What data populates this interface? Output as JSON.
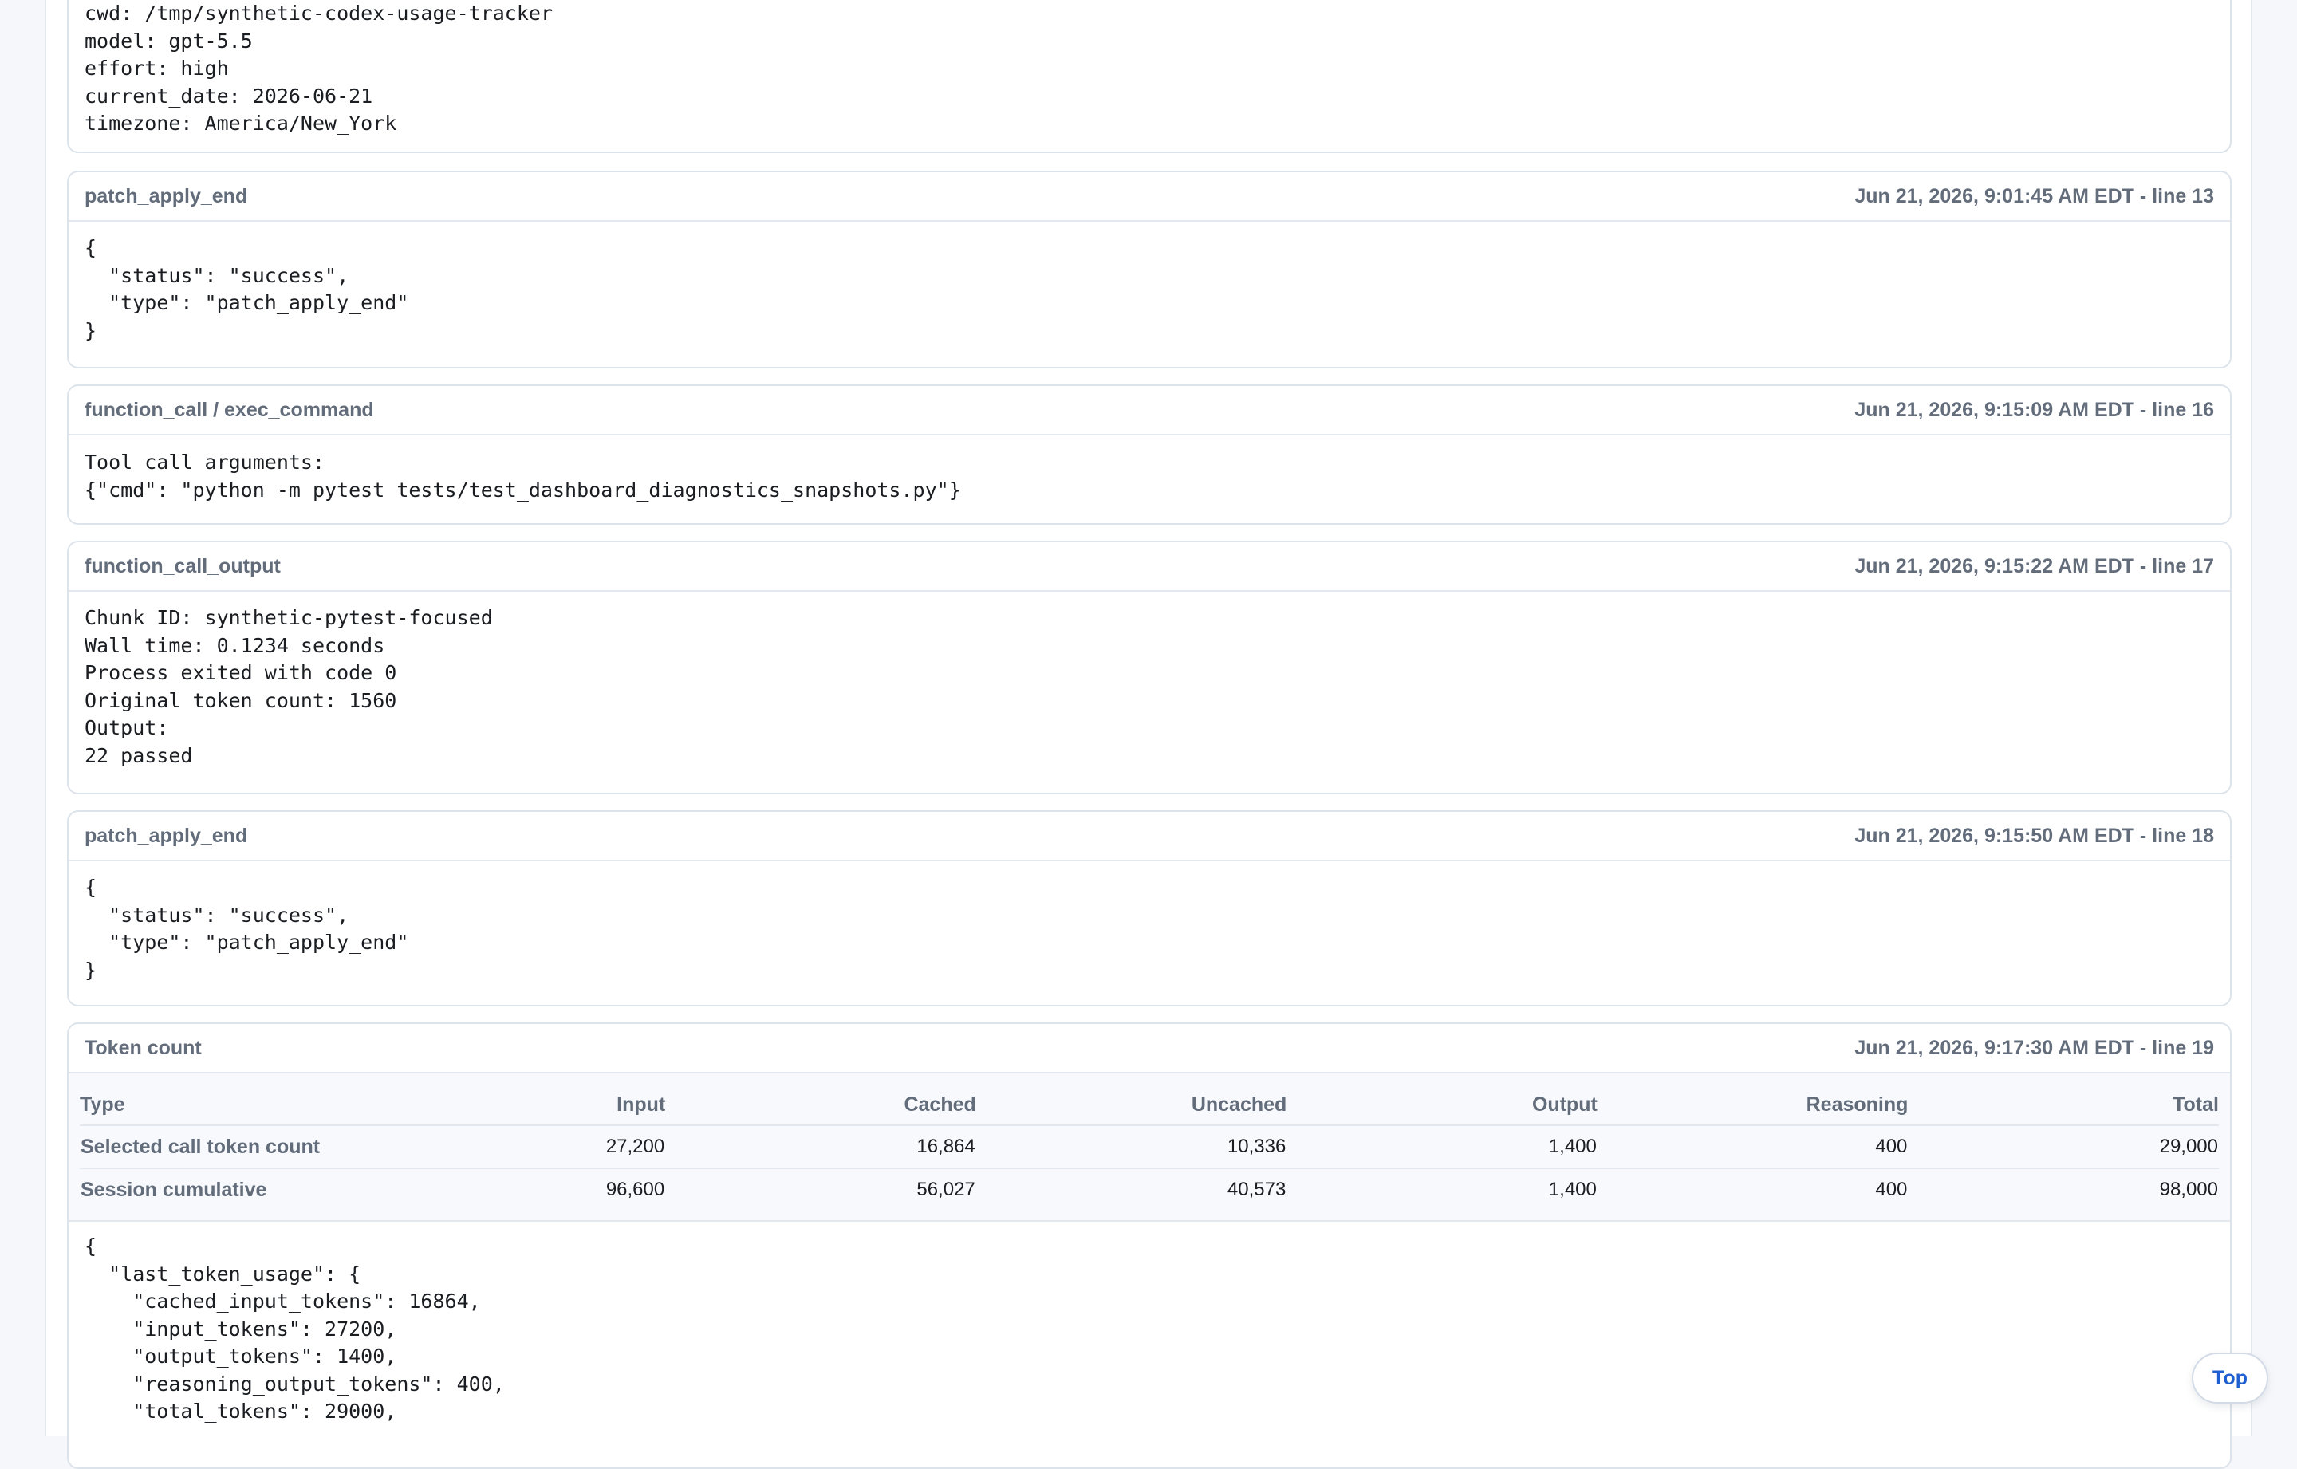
{
  "session_info": {
    "lines": [
      "cwd: /tmp/synthetic-codex-usage-tracker",
      "model: gpt-5.5",
      "effort: high",
      "current_date: 2026-06-21",
      "timezone: America/New_York"
    ]
  },
  "events": [
    {
      "title": "patch_apply_end",
      "meta": "Jun 21, 2026, 9:01:45 AM EDT - line 13",
      "body": "{\n  \"status\": \"success\",\n  \"type\": \"patch_apply_end\"\n}"
    },
    {
      "title": "function_call / exec_command",
      "meta": "Jun 21, 2026, 9:15:09 AM EDT - line 16",
      "body": "Tool call arguments:\n{\"cmd\": \"python -m pytest tests/test_dashboard_diagnostics_snapshots.py\"}"
    },
    {
      "title": "function_call_output",
      "meta": "Jun 21, 2026, 9:15:22 AM EDT - line 17",
      "body": "Chunk ID: synthetic-pytest-focused\nWall time: 0.1234 seconds\nProcess exited with code 0\nOriginal token count: 1560\nOutput:\n22 passed"
    },
    {
      "title": "patch_apply_end",
      "meta": "Jun 21, 2026, 9:15:50 AM EDT - line 18",
      "body": "{\n  \"status\": \"success\",\n  \"type\": \"patch_apply_end\"\n}"
    }
  ],
  "token_count": {
    "title": "Token count",
    "meta": "Jun 21, 2026, 9:17:30 AM EDT - line 19",
    "columns": [
      "Type",
      "Input",
      "Cached",
      "Uncached",
      "Output",
      "Reasoning",
      "Total"
    ],
    "rows": [
      [
        "Selected call token count",
        "27,200",
        "16,864",
        "10,336",
        "1,400",
        "400",
        "29,000"
      ],
      [
        "Session cumulative",
        "96,600",
        "56,027",
        "40,573",
        "1,400",
        "400",
        "98,000"
      ]
    ],
    "raw": "{\n  \"last_token_usage\": {\n    \"cached_input_tokens\": 16864,\n    \"input_tokens\": 27200,\n    \"output_tokens\": 1400,\n    \"reasoning_output_tokens\": 400,\n    \"total_tokens\": 29000,"
  },
  "top_button": {
    "label": "Top"
  },
  "colors": {
    "page_bg": "#f5f7fa",
    "card_border": "#dde3ea",
    "header_text": "#626c7a",
    "accent": "#1f5fd0"
  }
}
